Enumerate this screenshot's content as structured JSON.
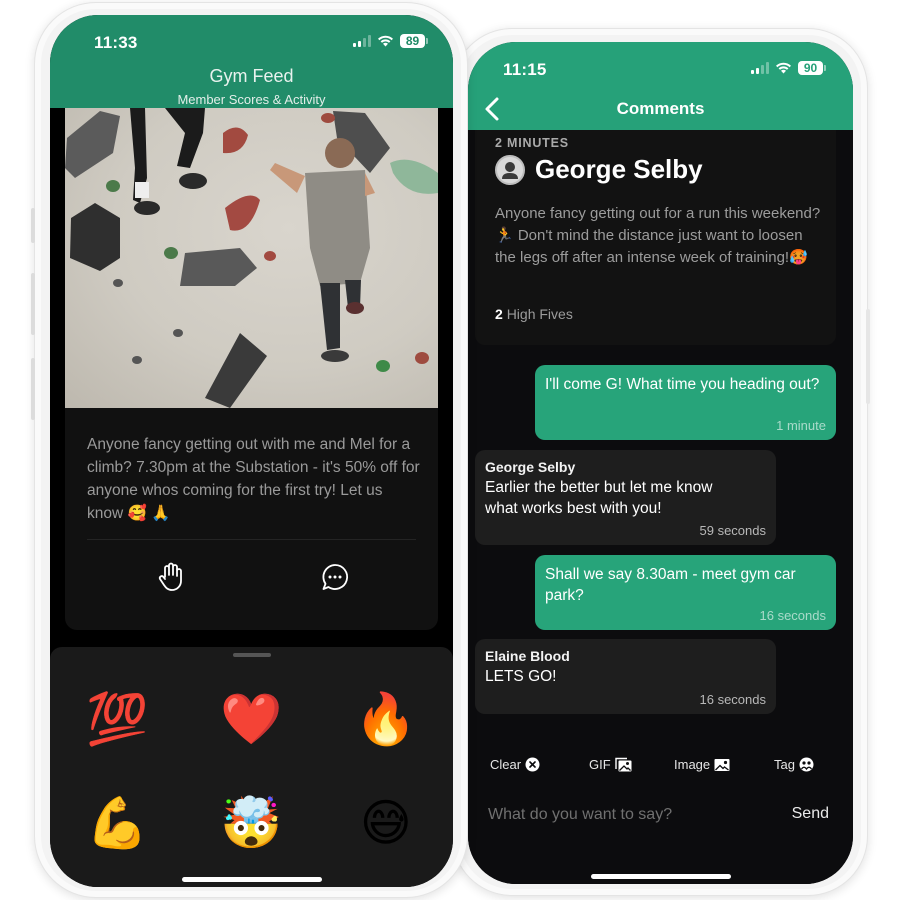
{
  "left_phone": {
    "status_bar": {
      "time": "11:33",
      "battery": "89"
    },
    "header": {
      "title": "Gym Feed",
      "subtitle": "Member Scores & Activity"
    },
    "post": {
      "image_alt": "Climbers on a bouldering wall",
      "text": "Anyone fancy getting out with me and Mel for a climb? 7.30pm at the Substation - it's 50% off for anyone whos coming for the first try! Let us know 🥰 🙏",
      "actions": [
        {
          "name": "high-five",
          "icon": "raised-hand-icon"
        },
        {
          "name": "comment",
          "icon": "speech-bubble-icon"
        }
      ]
    },
    "reactions": {
      "emojis": [
        {
          "name": "hundred-points",
          "glyph": "💯"
        },
        {
          "name": "red-heart",
          "glyph": "❤️"
        },
        {
          "name": "fire",
          "glyph": "🔥"
        },
        {
          "name": "flexed-biceps",
          "glyph": "💪"
        },
        {
          "name": "exploding-head",
          "glyph": "🤯"
        },
        {
          "name": "grinning-sweat",
          "glyph": "😅"
        }
      ]
    }
  },
  "right_phone": {
    "status_bar": {
      "time": "11:15",
      "battery": "90"
    },
    "header": {
      "title": "Comments",
      "back_icon": "chevron-left-icon"
    },
    "original_post": {
      "time_ago": "2 MINUTES",
      "author": "George Selby",
      "text": "Anyone fancy getting out for a run this weekend? 🏃   Don't mind the distance just want to loosen the legs off after an intense week of training!🥵",
      "high_fives_count": "2",
      "high_fives_label": "High Fives"
    },
    "comments": [
      {
        "mine": true,
        "author": "",
        "text": "I'll come G! What time you heading out?",
        "time": "1 minute"
      },
      {
        "mine": false,
        "author": "George Selby",
        "text": "Earlier the better but let me know what works best with you!",
        "time": "59 seconds"
      },
      {
        "mine": true,
        "author": "",
        "text": "Shall we say 8.30am - meet gym car park?",
        "time": "16 seconds"
      },
      {
        "mine": false,
        "author": "Elaine Blood",
        "text": "LETS GO!",
        "time": "16 seconds"
      }
    ],
    "composer": {
      "tools": [
        {
          "label": "Clear",
          "icon": "clear-circle-icon"
        },
        {
          "label": "GIF",
          "icon": "gif-image-icon"
        },
        {
          "label": "Image",
          "icon": "image-icon"
        },
        {
          "label": "Tag",
          "icon": "tag-people-icon"
        }
      ],
      "placeholder": "What do you want to say?",
      "value": "",
      "send_label": "Send"
    }
  },
  "colors": {
    "feed_header": "#218c69",
    "comments_header": "#26a179",
    "my_bubble": "#27a47a",
    "their_bubble": "#1e1e1e"
  }
}
